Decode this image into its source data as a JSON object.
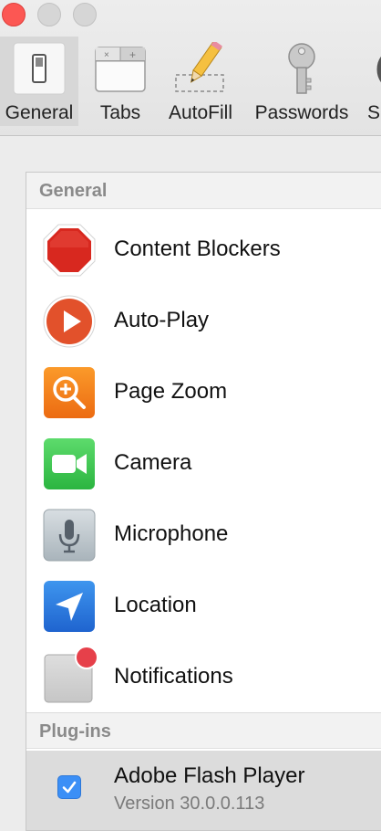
{
  "toolbar": {
    "items": [
      {
        "label": "General",
        "icon": "general-switch-icon",
        "selected": true
      },
      {
        "label": "Tabs",
        "icon": "tabs-icon"
      },
      {
        "label": "AutoFill",
        "icon": "autofill-pencil-icon"
      },
      {
        "label": "Passwords",
        "icon": "key-icon"
      },
      {
        "label": "S",
        "icon": "partial-icon"
      }
    ]
  },
  "sidebar": {
    "general_header": "General",
    "items": [
      {
        "label": "Content Blockers",
        "icon": "stop-sign-icon",
        "color": "#d8281f"
      },
      {
        "label": "Auto-Play",
        "icon": "play-icon",
        "color": "#e2512b"
      },
      {
        "label": "Page Zoom",
        "icon": "zoom-icon",
        "color": "#f07a17"
      },
      {
        "label": "Camera",
        "icon": "camera-icon",
        "color": "#35c24a"
      },
      {
        "label": "Microphone",
        "icon": "microphone-icon",
        "color": "#aab6be"
      },
      {
        "label": "Location",
        "icon": "location-arrow-icon",
        "color": "#2f7fe0"
      },
      {
        "label": "Notifications",
        "icon": "notifications-icon",
        "color": "#e6404a"
      }
    ],
    "plugins_header": "Plug-ins",
    "plugins": [
      {
        "name": "Adobe Flash Player",
        "version": "Version 30.0.0.113",
        "enabled": true
      }
    ]
  },
  "colors": {
    "close_button": "#fc5753",
    "checkbox_blue": "#3b8ff6"
  }
}
